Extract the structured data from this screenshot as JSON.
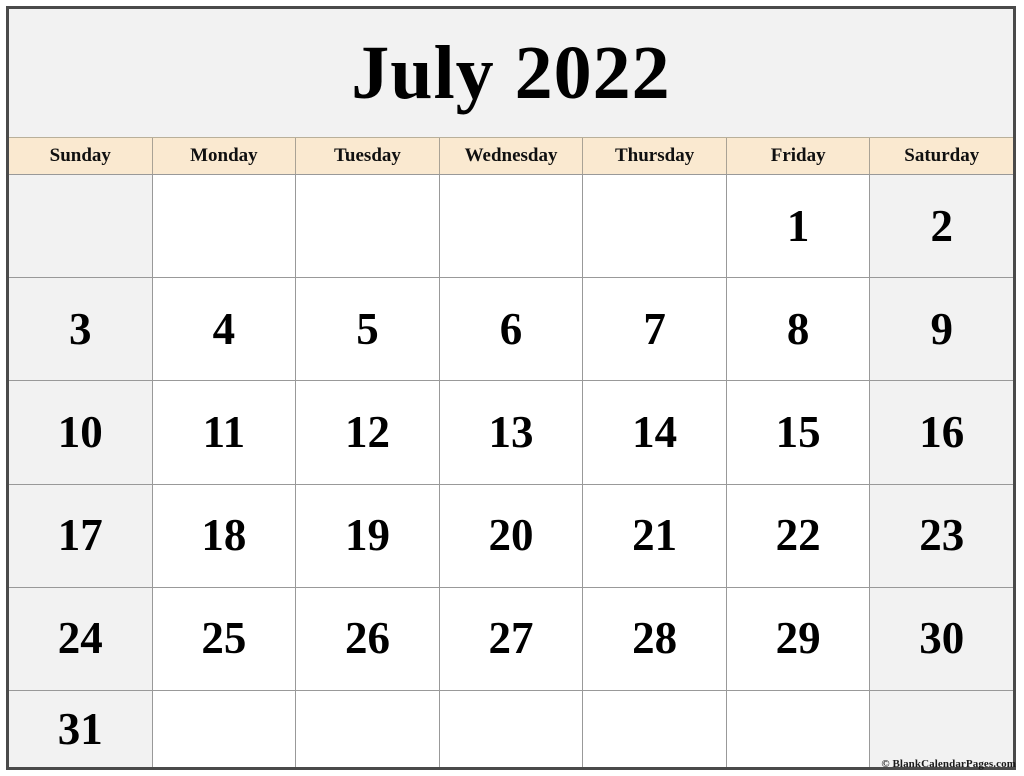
{
  "page": {
    "title": "July 2022",
    "month": "July",
    "year": "2022",
    "credit": "© BlankCalendarPages.com"
  },
  "colors": {
    "outer_border": "#4a4a4a",
    "grid_line": "#999999",
    "title_band_bg": "#f2f2f2",
    "weekday_header_bg": "#fae9d0",
    "weekend_cell_bg": "#f2f2f2",
    "weekday_cell_bg": "#ffffff",
    "text": "#000000"
  },
  "weekdays": [
    {
      "label": "Sunday",
      "weekend": true
    },
    {
      "label": "Monday",
      "weekend": false
    },
    {
      "label": "Tuesday",
      "weekend": false
    },
    {
      "label": "Wednesday",
      "weekend": false
    },
    {
      "label": "Thursday",
      "weekend": false
    },
    {
      "label": "Friday",
      "weekend": false
    },
    {
      "label": "Saturday",
      "weekend": true
    }
  ],
  "weeks": [
    {
      "days": [
        "",
        "",
        "",
        "",
        "",
        "1",
        "2"
      ]
    },
    {
      "days": [
        "3",
        "4",
        "5",
        "6",
        "7",
        "8",
        "9"
      ]
    },
    {
      "days": [
        "10",
        "11",
        "12",
        "13",
        "14",
        "15",
        "16"
      ]
    },
    {
      "days": [
        "17",
        "18",
        "19",
        "20",
        "21",
        "22",
        "23"
      ]
    },
    {
      "days": [
        "24",
        "25",
        "26",
        "27",
        "28",
        "29",
        "30"
      ]
    },
    {
      "days": [
        "31",
        "",
        "",
        "",
        "",
        "",
        ""
      ]
    }
  ]
}
